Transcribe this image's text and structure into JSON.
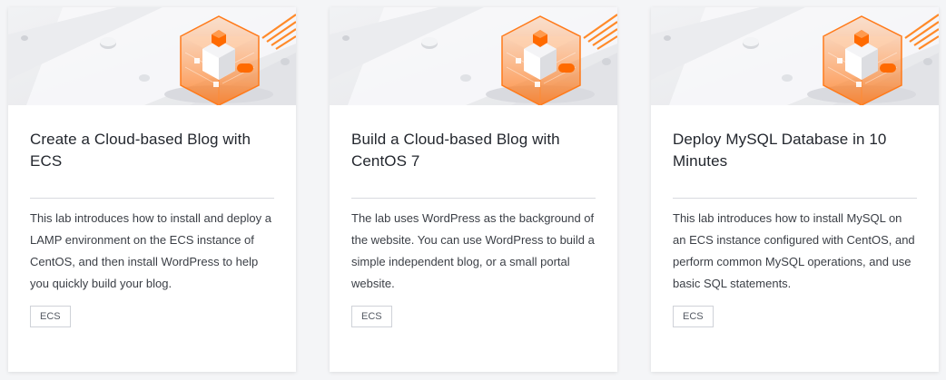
{
  "cards": [
    {
      "title": "Create a Cloud-based Blog with ECS",
      "description": "This lab introduces how to install and deploy a LAMP environment on the ECS instance of CentOS, and then install WordPress to help you quickly build your blog.",
      "tag": "ECS",
      "image_icon": "cloud-server-cube-illustration"
    },
    {
      "title": "Build a Cloud-based Blog with CentOS 7",
      "description": "The lab uses WordPress as the background of the website. You can use WordPress to build a simple independent blog, or a small portal website.",
      "tag": "ECS",
      "image_icon": "cloud-server-cube-illustration"
    },
    {
      "title": "Deploy MySQL Database in 10 Minutes",
      "description": "This lab introduces how to install MySQL on an ECS instance configured with CentOS, and perform common MySQL operations, and use basic SQL statements.",
      "tag": "ECS",
      "image_icon": "cloud-server-cube-illustration"
    }
  ],
  "colors": {
    "accent": "#ff6a00",
    "title_text": "#23272e",
    "body_text": "#3b3f46",
    "banner_bg": "#eeeff2"
  }
}
